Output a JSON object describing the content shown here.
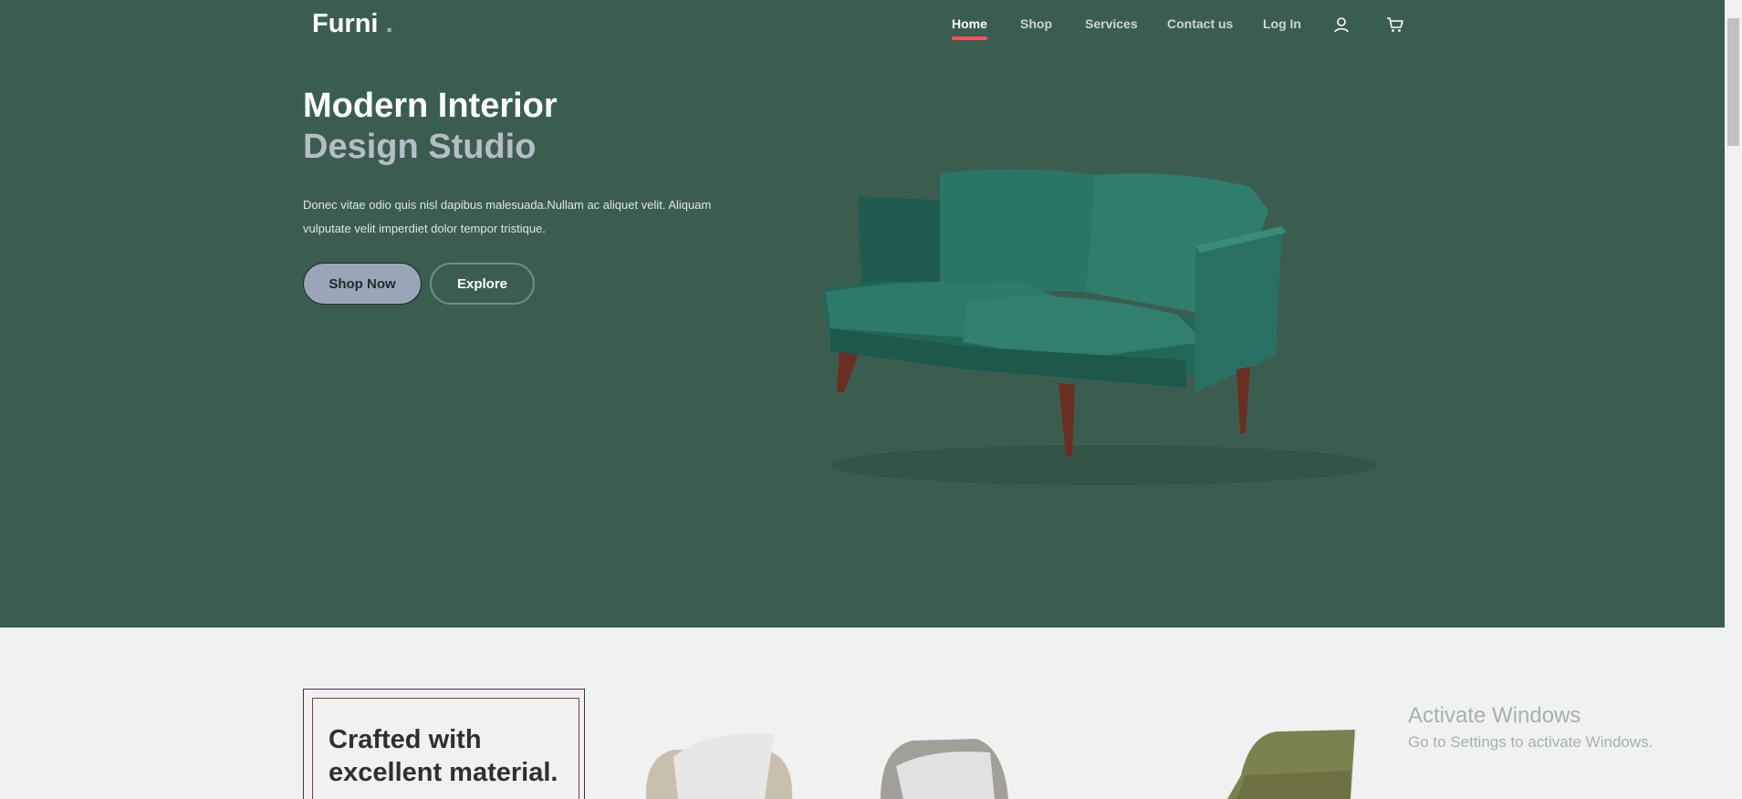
{
  "brand": {
    "name": "Furni",
    "dot": "."
  },
  "nav": {
    "items": [
      {
        "label": "Home",
        "active": true
      },
      {
        "label": "Shop",
        "active": false
      },
      {
        "label": "Services",
        "active": false
      },
      {
        "label": "Contact us",
        "active": false
      },
      {
        "label": "Log In",
        "active": false
      }
    ],
    "icons": [
      "user-icon",
      "cart-icon"
    ]
  },
  "hero": {
    "title_line1": "Modern Interior",
    "title_line2": "Design Studio",
    "text": "Donec vitae odio quis nisl dapibus malesuada.Nullam ac aliquet velit. Aliquam vulputate velit imperdiet dolor tempor tristique.",
    "primary_button": "Shop Now",
    "secondary_button": "Explore"
  },
  "section": {
    "card_title": "Crafted with excellent material."
  },
  "watermark": {
    "title": "Activate Windows",
    "subtitle": "Go to Settings to activate Windows."
  },
  "colors": {
    "hero_bg": "#3b5d50",
    "accent": "#f9515e",
    "page_bg": "#eff2f1",
    "primary_button": "#9aa5b8"
  }
}
